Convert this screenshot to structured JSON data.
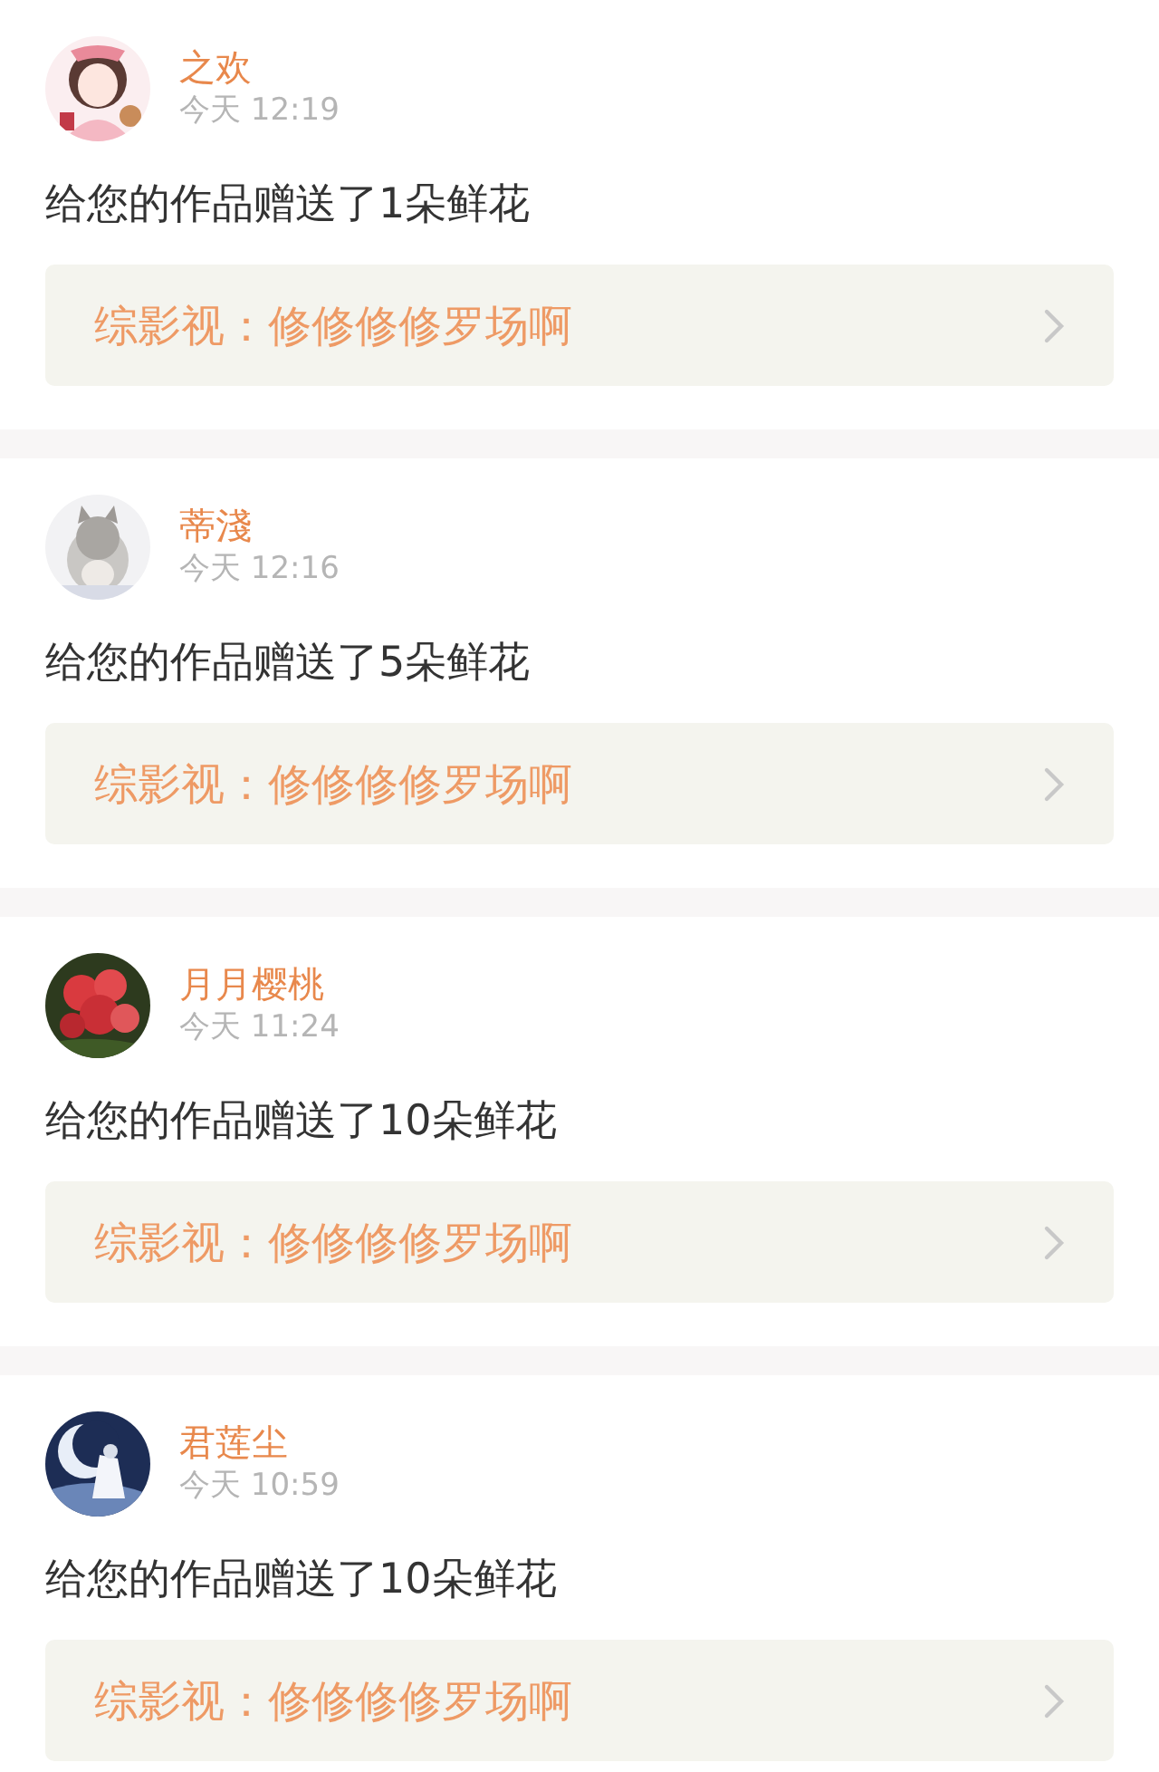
{
  "notifications": [
    {
      "name": "之欢",
      "time": "今天 12:19",
      "message": "给您的作品赠送了1朵鲜花",
      "work_link": "综影视：修修修修罗场啊"
    },
    {
      "name": "蒂淺",
      "time": "今天 12:16",
      "message": "给您的作品赠送了5朵鲜花",
      "work_link": "综影视：修修修修罗场啊"
    },
    {
      "name": "月月樱桃",
      "time": "今天 11:24",
      "message": "给您的作品赠送了10朵鲜花",
      "work_link": "综影视：修修修修罗场啊"
    },
    {
      "name": "君莲尘",
      "time": "今天 10:59",
      "message": "给您的作品赠送了10朵鲜花",
      "work_link": "综影视：修修修修罗场啊"
    }
  ]
}
